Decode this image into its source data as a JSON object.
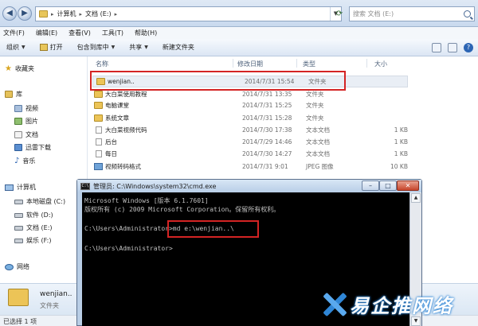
{
  "explorer": {
    "breadcrumb": [
      "计算机",
      "文档 (E:)"
    ],
    "search_placeholder": "搜索 文档 (E:)",
    "menu": [
      "文件(F)",
      "编辑(E)",
      "查看(V)",
      "工具(T)",
      "帮助(H)"
    ],
    "toolbar": {
      "organize": "组织",
      "open": "打开",
      "include_in_library": "包含到库中",
      "share": "共享",
      "new_folder": "新建文件夹"
    },
    "nav": {
      "favorites": "收藏夹",
      "libraries": "库",
      "videos": "视频",
      "pictures": "图片",
      "documents": "文档",
      "downloads": "迅雷下载",
      "music": "音乐",
      "computer": "计算机",
      "drive_c": "本地磁盘 (C:)",
      "drive_d": "软件 (D:)",
      "drive_e": "文档 (E:)",
      "drive_f": "娱乐 (F:)",
      "network": "网络"
    },
    "columns": {
      "name": "名称",
      "modified": "修改日期",
      "type": "类型",
      "size": "大小"
    },
    "files": [
      {
        "name": "wenjian..",
        "date": "2014/7/31 15:54",
        "type": "文件夹",
        "size": "",
        "kind": "folder"
      },
      {
        "name": "大白菜使用教程",
        "date": "2014/7/31 13:35",
        "type": "文件夹",
        "size": "",
        "kind": "folder"
      },
      {
        "name": "电脑课堂",
        "date": "2014/7/31 15:25",
        "type": "文件夹",
        "size": "",
        "kind": "folder"
      },
      {
        "name": "系统文章",
        "date": "2014/7/31 15:28",
        "type": "文件夹",
        "size": "",
        "kind": "folder"
      },
      {
        "name": "大白菜视频代码",
        "date": "2014/7/30 17:38",
        "type": "文本文档",
        "size": "1 KB",
        "kind": "txt"
      },
      {
        "name": "后台",
        "date": "2014/7/29 14:46",
        "type": "文本文档",
        "size": "1 KB",
        "kind": "txt"
      },
      {
        "name": "每日",
        "date": "2014/7/30 14:27",
        "type": "文本文档",
        "size": "1 KB",
        "kind": "txt"
      },
      {
        "name": "视频转码格式",
        "date": "2014/7/31 9:01",
        "type": "JPEG 图像",
        "size": "10 KB",
        "kind": "jpg"
      }
    ],
    "details": {
      "name": "wenjian..",
      "type": "文件夹"
    },
    "status": "已选择 1 项"
  },
  "cmd": {
    "title": "管理员: C:\\Windows\\system32\\cmd.exe",
    "icon_label": "C:\\",
    "lines": [
      "Microsoft Windows [版本 6.1.7601]",
      "版权所有 (c) 2009 Microsoft Corporation。保留所有权利。",
      "",
      "C:\\Users\\Administrator>md e:\\wenjian..\\",
      "",
      "C:\\Users\\Administrator>"
    ]
  },
  "watermark": {
    "text": "易企推网络"
  },
  "colors": {
    "highlight": "#d42424",
    "console_bg": "#000000",
    "console_fg": "#c0c0c0",
    "watermark_blue": "#2f86d6"
  }
}
